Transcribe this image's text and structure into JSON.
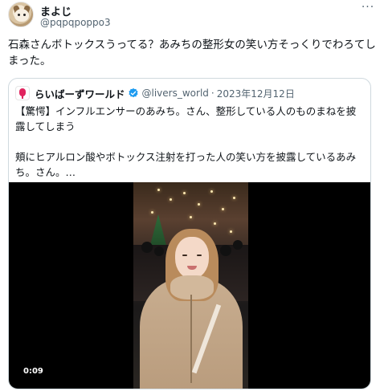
{
  "tweet": {
    "display_name": "まよじ",
    "handle": "@pqpqpoppo3",
    "more_icon": "more-horizontal-icon",
    "text": "石森さんボトックスうってる？あみちの整形女の笑い方そっくりでわろてしまった。"
  },
  "quote": {
    "name": "らいばーずワールド",
    "verified_icon": "verified-badge-icon",
    "handle": "@livers_world",
    "separator": "·",
    "date": "2023年12月12日",
    "text_line1": "【驚愕】インフルエンサーのあみち。さん、整形している人のものまねを披露してしまう",
    "text_line2": "頬にヒアルロン酸やボトックス注射を打った人の笑い方を披露しているあみち。さん。…"
  },
  "video": {
    "timestamp": "0:09"
  },
  "colors": {
    "text_primary": "#0f1419",
    "text_secondary": "#536471",
    "border": "#cfd9de",
    "verified": "#1d9bf0",
    "video_bg": "#000000"
  }
}
